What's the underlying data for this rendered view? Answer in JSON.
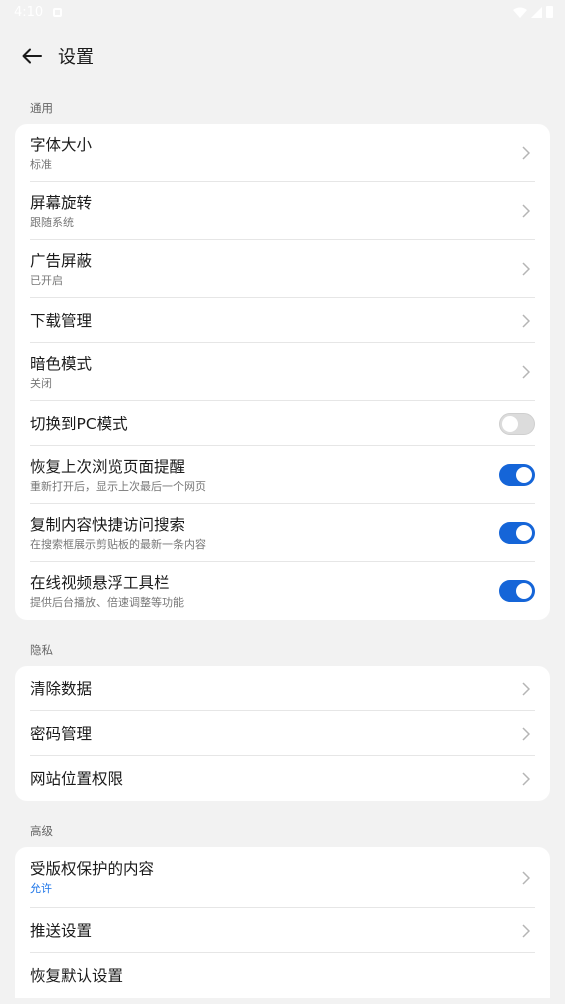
{
  "status": {
    "time": "4:10"
  },
  "header": {
    "title": "设置"
  },
  "sections": {
    "general": {
      "label": "通用",
      "font_size": {
        "title": "字体大小",
        "sub": "标准"
      },
      "rotation": {
        "title": "屏幕旋转",
        "sub": "跟随系统"
      },
      "adblock": {
        "title": "广告屏蔽",
        "sub": "已开启"
      },
      "downloads": {
        "title": "下载管理"
      },
      "dark_mode": {
        "title": "暗色模式",
        "sub": "关闭"
      },
      "pc_mode": {
        "title": "切换到PC模式",
        "enabled": false
      },
      "restore_tabs": {
        "title": "恢复上次浏览页面提醒",
        "sub": "重新打开后，显示上次最后一个网页",
        "enabled": true
      },
      "clipboard_search": {
        "title": "复制内容快捷访问搜索",
        "sub": "在搜索框展示剪贴板的最新一条内容",
        "enabled": true
      },
      "video_toolbar": {
        "title": "在线视频悬浮工具栏",
        "sub": "提供后台播放、倍速调整等功能",
        "enabled": true
      }
    },
    "privacy": {
      "label": "隐私",
      "clear_data": {
        "title": "清除数据"
      },
      "passwords": {
        "title": "密码管理"
      },
      "site_location": {
        "title": "网站位置权限"
      }
    },
    "advanced": {
      "label": "高级",
      "drm": {
        "title": "受版权保护的内容",
        "sub": "允许"
      },
      "push": {
        "title": "推送设置"
      },
      "reset": {
        "title": "恢复默认设置"
      }
    }
  },
  "colors": {
    "accent": "#1565d8",
    "link": "#1a73e8",
    "background": "#f2f2f2"
  }
}
